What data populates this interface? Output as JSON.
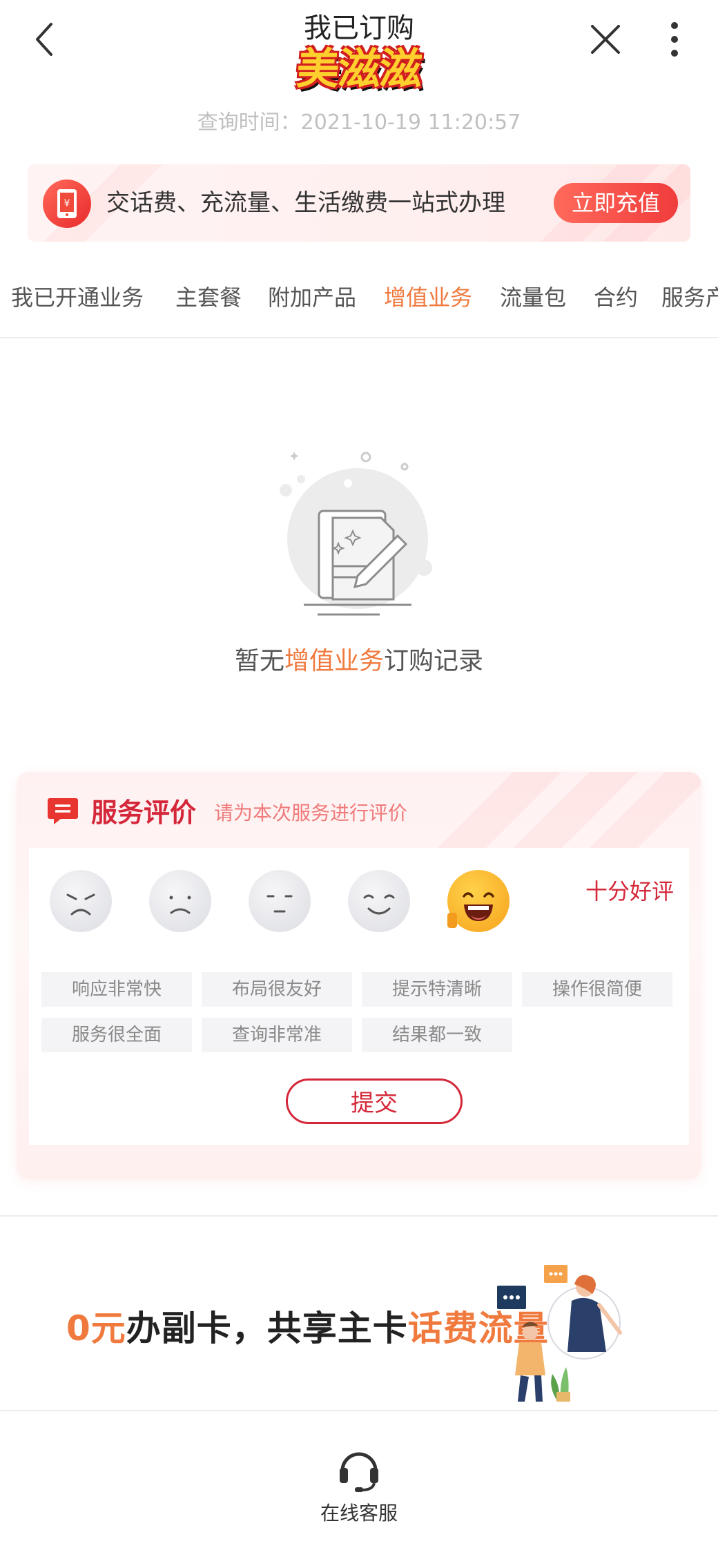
{
  "header": {
    "title": "我已订购",
    "logo_text": "美滋滋",
    "query_time": "查询时间：2021-10-19 11:20:57"
  },
  "banner": {
    "text": "交话费、充流量、生活缴费一站式办理",
    "button": "立即充值"
  },
  "tabs": [
    {
      "label": "我已开通业务",
      "active": false
    },
    {
      "label": "主套餐",
      "active": false
    },
    {
      "label": "附加产品",
      "active": false
    },
    {
      "label": "增值业务",
      "active": true
    },
    {
      "label": "流量包",
      "active": false
    },
    {
      "label": "合约",
      "active": false
    },
    {
      "label": "服务产",
      "active": false
    }
  ],
  "empty": {
    "prefix": "暂无",
    "highlight": "增值业务",
    "suffix": "订购记录"
  },
  "evaluation": {
    "title": "服务评价",
    "subtitle": "请为本次服务进行评价",
    "rating_label": "十分好评",
    "selected_level": 5,
    "tags": [
      "响应非常快",
      "布局很友好",
      "提示特清晰",
      "操作很简便",
      "服务很全面",
      "查询非常准",
      "结果都一致"
    ],
    "submit": "提交"
  },
  "promo": {
    "part1": "0元",
    "part2": "办副卡，共享主卡",
    "part3": "话费流量"
  },
  "bottom": {
    "label": "在线客服"
  },
  "colors": {
    "accent_orange": "#f07a3e",
    "brand_red": "#d4283a"
  }
}
